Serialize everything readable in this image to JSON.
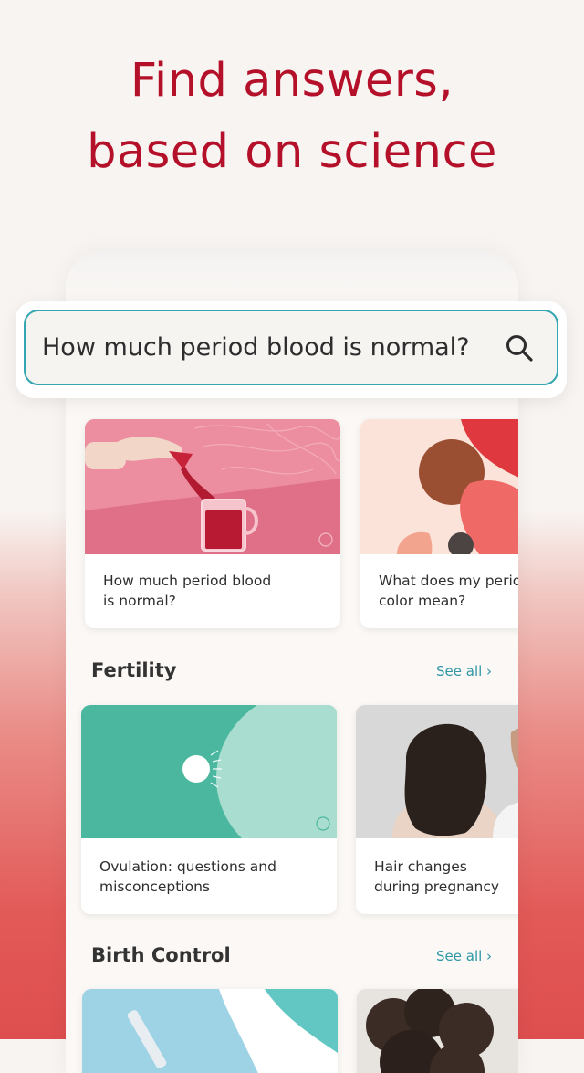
{
  "headline": {
    "line1": "Find answers,",
    "line2": "based on science"
  },
  "search": {
    "query": "How much period blood is normal?"
  },
  "featured_cards": [
    {
      "caption_line1": "How much period blood",
      "caption_line2": "is normal?"
    },
    {
      "caption_line1": "What does my period",
      "caption_line2": "color mean?"
    }
  ],
  "sections": [
    {
      "title": "Fertility",
      "see_all": "See all ›",
      "cards": [
        {
          "caption_line1": "Ovulation: questions and",
          "caption_line2": "misconceptions"
        },
        {
          "caption_line1": "Hair changes",
          "caption_line2": "during pregnancy"
        }
      ]
    },
    {
      "title": "Birth Control",
      "see_all": "See all ›"
    }
  ],
  "colors": {
    "brand_red": "#b4102a",
    "accent_teal": "#35a6b1",
    "link": "#2f97a6"
  }
}
